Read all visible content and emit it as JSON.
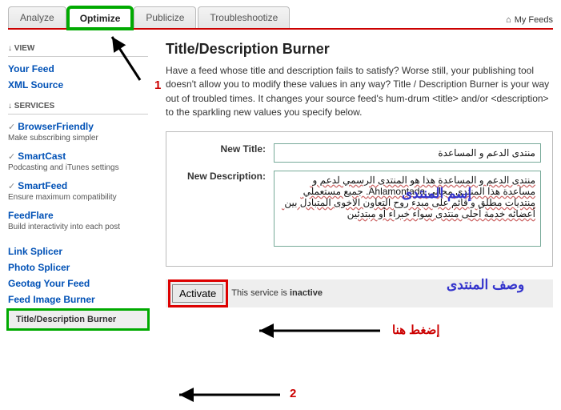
{
  "tabs": {
    "analyze": "Analyze",
    "optimize": "Optimize",
    "publicize": "Publicize",
    "troubleshoot": "Troubleshootize"
  },
  "header": {
    "myfeeds": "My Feeds"
  },
  "sidebar": {
    "view_head": "↓ VIEW",
    "your_feed": "Your Feed",
    "xml_source": "XML Source",
    "services_head": "↓ SERVICES",
    "services": [
      {
        "title": "BrowserFriendly",
        "desc": "Make subscribing simpler",
        "check": true
      },
      {
        "title": "SmartCast",
        "desc": "Podcasting and iTunes settings",
        "check": true
      },
      {
        "title": "SmartFeed",
        "desc": "Ensure maximum compatibility",
        "check": true
      },
      {
        "title": "FeedFlare",
        "desc": "Build interactivity into each post",
        "check": false
      }
    ],
    "link_splicer": "Link Splicer",
    "photo_splicer": "Photo Splicer",
    "geotag": "Geotag Your Feed",
    "feed_image": "Feed Image Burner",
    "current": "Title/Description Burner"
  },
  "page": {
    "title": "Title/Description Burner",
    "intro": "Have a feed whose title and description fails to satisfy? Worse still, your publishing tool doesn't allow you to modify these values in any way? Title / Description Burner is your way out of troubled times. It changes your source feed's hum-drum <title> and/or <description> to the sparkling new values you specify below."
  },
  "form": {
    "title_label": "New Title:",
    "title_value": "منتدى الدعم و المساعدة",
    "desc_label": "New Description:",
    "desc_value": "منتدى الدعم و المساعدة هذا هو المنتدى الرسمي لدعم و مساعدة هذا المنتدى مجاني Ahlamontada. جميع مستعملي منتديات مطلق و قائم على مبدء روح التعاون الاخوى المتبادل بين أعضائه خدمة أحلى منتدى سواء خبراء أو مبتدئين"
  },
  "action": {
    "activate": "Activate",
    "status_prefix": "This service is ",
    "status_state": "inactive"
  },
  "annotations": {
    "num1": "1",
    "num2": "2",
    "label_name": "إسم المنتدى",
    "label_desc": "وصف المنتدى",
    "press_here": "إضغط هنا"
  }
}
